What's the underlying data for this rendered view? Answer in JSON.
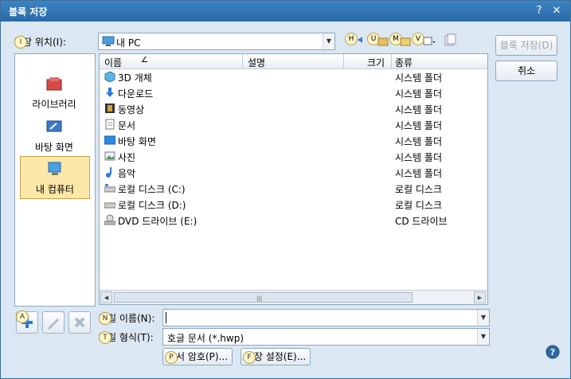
{
  "window": {
    "title": "블록 저장",
    "help_glyph": "?",
    "close_glyph": "✕"
  },
  "location": {
    "label": "저장 위치(I):",
    "value": "내 PC",
    "badge": "I"
  },
  "toolbar": {
    "h": "H",
    "u": "U",
    "m": "M",
    "v": "V"
  },
  "places": [
    {
      "label": "라이브러리",
      "icon": "library-icon"
    },
    {
      "label": "바탕 화면",
      "icon": "desktop-icon"
    },
    {
      "label": "내 컴퓨터",
      "icon": "my-computer-icon",
      "selected": true
    }
  ],
  "list": {
    "headers": {
      "name": "이름",
      "sort": "∠",
      "desc": "설명",
      "size": "크기",
      "type": "종류"
    },
    "rows": [
      {
        "name": "3D 개체",
        "type": "시스템 폴더",
        "icon": "3d-objects-icon"
      },
      {
        "name": "다운로드",
        "type": "시스템 폴더",
        "icon": "download-icon"
      },
      {
        "name": "동영상",
        "type": "시스템 폴더",
        "icon": "video-icon"
      },
      {
        "name": "문서",
        "type": "시스템 폴더",
        "icon": "document-icon"
      },
      {
        "name": "바탕 화면",
        "type": "시스템 폴더",
        "icon": "desktop-icon"
      },
      {
        "name": "사진",
        "type": "시스템 폴더",
        "icon": "picture-icon"
      },
      {
        "name": "음악",
        "type": "시스템 폴더",
        "icon": "music-icon"
      },
      {
        "name": "로컬 디스크 (C:)",
        "type": "로컬 디스크",
        "icon": "local-disk-icon"
      },
      {
        "name": "로컬 디스크 (D:)",
        "type": "로컬 디스크",
        "icon": "local-disk-icon"
      },
      {
        "name": "DVD 드라이브 (E:)",
        "type": "CD 드라이브",
        "icon": "dvd-drive-icon"
      }
    ],
    "scroll_grip": "|||"
  },
  "side_buttons": {
    "save": "블록 저장(D)",
    "cancel": "취소"
  },
  "bottom": {
    "add_badge": "A",
    "filename": {
      "label": "파일 이름(N):",
      "badge": "N",
      "value": ""
    },
    "filetype": {
      "label": "파일 형식(T):",
      "badge": "T",
      "value": "호글 문서 (*.hwp)"
    },
    "password": {
      "label": "문서 암호(P)...",
      "badge": "P"
    },
    "settings": {
      "label": "저장 설정(E)...",
      "badge": "F"
    }
  }
}
